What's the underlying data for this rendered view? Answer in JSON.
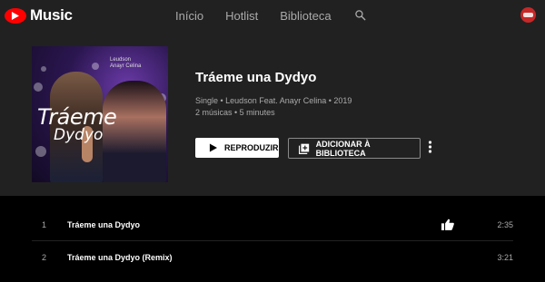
{
  "app": {
    "logo_text": "Music",
    "logo_icon": "youtube-play-icon"
  },
  "nav": {
    "items": [
      "Início",
      "Hotlist",
      "Biblioteca"
    ],
    "search_icon": "search-icon"
  },
  "album": {
    "cover_title": "Tráeme",
    "cover_subtitle": "Dydyo",
    "cover_credits": [
      "Leudson",
      "Anayr Celina"
    ],
    "title": "Tráeme una Dydyo",
    "meta_line1": "Single • Leudson Feat. Anayr Celina • 2019",
    "meta_line2": "2 músicas • 5 minutes"
  },
  "actions": {
    "play_label": "REPRODUZIR",
    "add_label": "ADICIONAR À BIBLIOTECA",
    "more_icon": "more-vert-icon"
  },
  "tracks": [
    {
      "index": "1",
      "title": "Tráeme una Dydyo",
      "duration": "2:35",
      "liked": true
    },
    {
      "index": "2",
      "title": "Tráeme una Dydyo (Remix)",
      "duration": "3:21",
      "liked": false
    }
  ],
  "colors": {
    "accent": "#ff0000",
    "header_bg": "#212121",
    "body_bg": "#000000",
    "secondary_text": "#aaaaaa"
  }
}
